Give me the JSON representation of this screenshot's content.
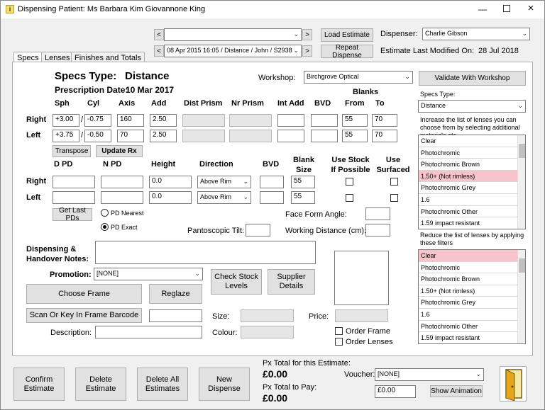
{
  "window": {
    "title": "Dispensing Patient:  Ms Barbara Kim Giovannone King",
    "icon": "app-i-icon"
  },
  "nav": {
    "prev": "<",
    "next": ">",
    "top_value": "",
    "bottom_value": "08 Apr 2015 16:05 / Distance / John / S2938"
  },
  "toolbar": {
    "load_estimate": "Load Estimate",
    "repeat_dispense": "Repeat Dispense",
    "dispenser_label": "Dispenser:",
    "dispenser_value": "Charlie Gibson",
    "last_modified_label": "Estimate Last Modified On:",
    "last_modified_value": "28 Jul 2018"
  },
  "tabs": [
    "Specs",
    "Lenses",
    "Finishes and Totals"
  ],
  "specs": {
    "type_label": "Specs Type:",
    "type_value": "Distance",
    "prescription_label": "Prescription Date:",
    "prescription_value": "10 Mar 2017",
    "workshop_label": "Workshop:",
    "workshop_value": "Birchgrove Optical",
    "validate_button": "Validate With Workshop",
    "blanks_header": "Blanks",
    "columns": {
      "sph": "Sph",
      "cyl": "Cyl",
      "axis": "Axis",
      "add": "Add",
      "dist_prism": "Dist Prism",
      "nr_prism": "Nr Prism",
      "int_add": "Int Add",
      "bvd": "BVD",
      "from": "From",
      "to": "To"
    },
    "right_label": "Right",
    "left_label": "Left",
    "right": {
      "sph": "+3.00",
      "cyl": "-0.75",
      "axis": "160",
      "add": "2.50",
      "from": "55",
      "to": "70"
    },
    "left": {
      "sph": "+3.75",
      "cyl": "-0.50",
      "axis": "70",
      "add": "2.50",
      "from": "55",
      "to": "70"
    },
    "slash": "/",
    "transpose": "Transpose",
    "update_rx": "Update Rx"
  },
  "pd": {
    "columns": {
      "dpd": "D PD",
      "npd": "N PD",
      "height": "Height",
      "direction": "Direction",
      "bvd": "BVD",
      "blank_size": "Blank\nSize",
      "use_stock": "Use Stock\nIf Possible",
      "use_surfaced": "Use\nSurfaced"
    },
    "right_label": "Right",
    "left_label": "Left",
    "right": {
      "height": "0.0",
      "direction": "Above Rim",
      "blank": "55"
    },
    "left": {
      "height": "0.0",
      "direction": "Above Rim",
      "blank": "55"
    },
    "get_last_pds": "Get Last PDs",
    "pd_nearest": "PD Nearest",
    "pd_exact": "PD Exact",
    "face_form_label": "Face Form Angle:",
    "pantoscopic_label": "Pantoscopic Tilt:",
    "working_distance_label": "Working Distance (cm):"
  },
  "frame": {
    "notes_label": "Dispensing &\nHandover Notes:",
    "promotion_label": "Promotion:",
    "promotion_value": "[NONE]",
    "check_stock": "Check Stock\nLevels",
    "supplier_details": "Supplier\nDetails",
    "choose_frame": "Choose Frame",
    "reglaze": "Reglaze",
    "scan_barcode": "Scan Or Key In Frame Barcode",
    "size_label": "Size:",
    "price_label": "Price:",
    "colour_label": "Colour:",
    "description_label": "Description:",
    "order_frame": "Order Frame",
    "order_lenses": "Order Lenses"
  },
  "lens_panel": {
    "specs_type_label": "Specs Type:",
    "specs_type_value": "Distance",
    "increase_text": "Increase the list of lenses you can choose from by selecting additional materials etc",
    "increase_items": [
      "Clear",
      "Photochromic",
      "Photochromic Brown",
      "1.50+ (Not rimless)",
      "Photochromic Grey",
      "1.6",
      "Photochromic Other",
      "1.59 impact resistant"
    ],
    "increase_highlight_index": 3,
    "reduce_text": "Reduce the list of lenses by applying these filters",
    "reduce_items": [
      "Clear",
      "Photochromic",
      "Photochromic Brown",
      "1.50+ (Not rimless)",
      "Photochromic Grey",
      "1.6",
      "Photochromic Other",
      "1.59 impact resistant"
    ],
    "reduce_highlight_index": 0
  },
  "footer": {
    "confirm": "Confirm\nEstimate",
    "delete": "Delete\nEstimate",
    "delete_all": "Delete All\nEstimates",
    "new_dispense": "New\nDispense",
    "px_total_label": "Px Total for this Estimate:",
    "px_total_value": "£0.00",
    "px_pay_label": "Px Total to Pay:",
    "px_pay_value": "£0.00",
    "voucher_label": "Voucher:",
    "voucher_value": "[NONE]",
    "voucher_amount": "£0.00",
    "show_animation": "Show Animation",
    "exit_icon": "exit-door-icon"
  },
  "colors": {
    "highlight": "#f8c4cc",
    "window_bg": "#f0f0f0"
  }
}
